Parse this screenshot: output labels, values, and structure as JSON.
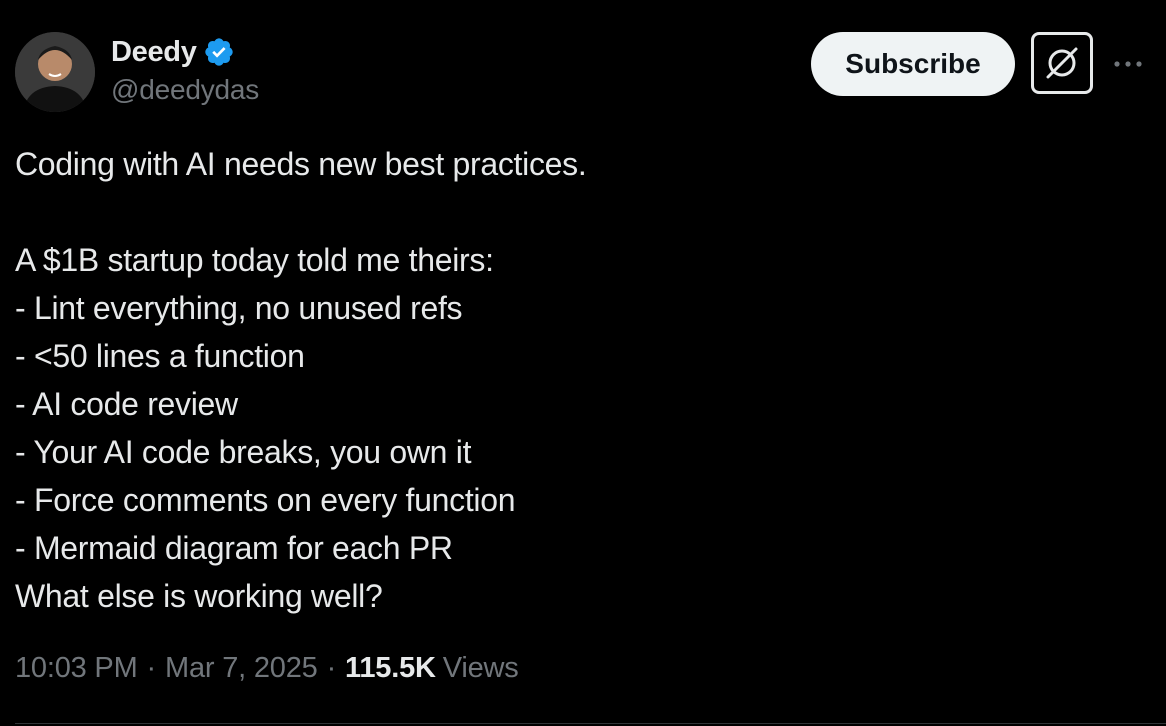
{
  "author": {
    "display_name": "Deedy",
    "handle": "@deedydas",
    "verified": true,
    "verified_color": "#1d9bf0",
    "avatar_icon": "user-avatar"
  },
  "header_actions": {
    "subscribe_label": "Subscribe",
    "grok_icon": "grok-icon",
    "more_icon": "more-icon"
  },
  "tweet": {
    "lines": [
      "Coding with AI needs new best practices.",
      "",
      "A $1B startup today told me theirs:",
      "- Lint everything, no unused refs",
      "- <50 lines a function",
      "- AI code review",
      "- Your AI code breaks, you own it",
      "- Force comments on every function",
      "- Mermaid diagram for each PR",
      "What else is working well?"
    ]
  },
  "meta": {
    "time": "10:03 PM",
    "separator": "·",
    "date": "Mar 7, 2025",
    "views_count": "115.5K",
    "views_label": "Views"
  },
  "colors": {
    "background": "#000000",
    "text_primary": "#e7e9ea",
    "text_secondary": "#71767b",
    "subscribe_bg": "#eff3f4",
    "subscribe_text": "#0f1419"
  }
}
